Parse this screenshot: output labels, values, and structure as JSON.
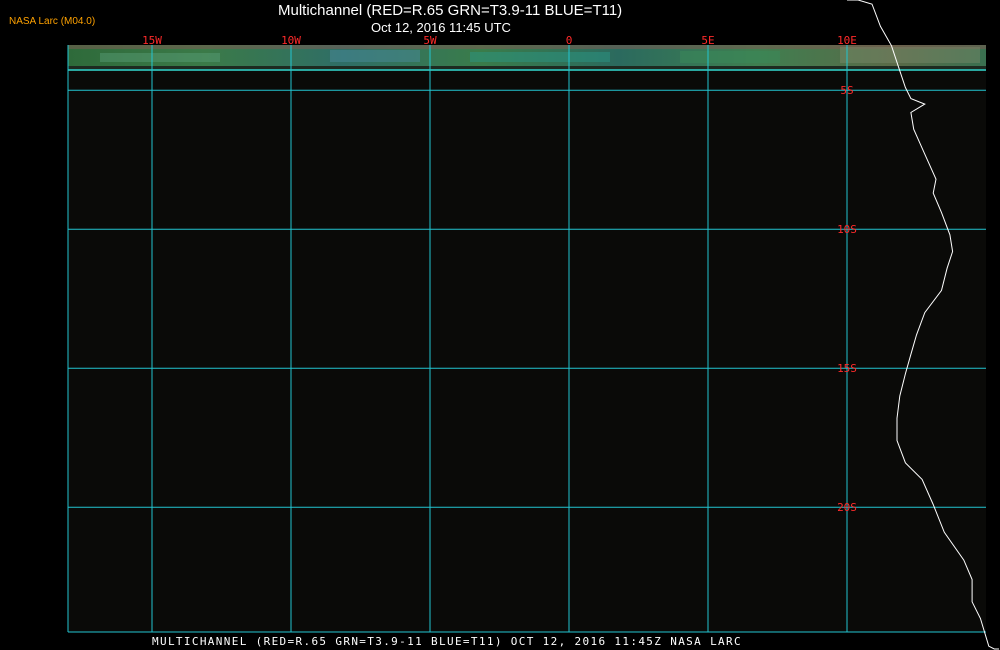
{
  "header": {
    "product_id": "NASA Larc (M04.0)",
    "title": "Multichannel (RED=R.65 GRN=T3.9-11 BLUE=T11)",
    "subtitle": "Oct 12, 2016 11:45 UTC"
  },
  "footer": {
    "caption": "MULTICHANNEL (RED=R.65 GRN=T3.9-11 BLUE=T11) OCT 12, 2016 11:45Z  NASA LARC"
  },
  "map": {
    "colors": {
      "background": "#000000",
      "panel": "#0a0a08",
      "grid": "#22c4d0",
      "grid_labels": "#ff2a2a",
      "coastline": "#ffffff",
      "imagery_green": "#2e6e3e",
      "imagery_teal": "#2aa8a0"
    },
    "longitude_labels": [
      {
        "lon": -15,
        "label": "15W"
      },
      {
        "lon": -10,
        "label": "10W"
      },
      {
        "lon": -5,
        "label": "5W"
      },
      {
        "lon": 0,
        "label": "0"
      },
      {
        "lon": 5,
        "label": "5E"
      },
      {
        "lon": 10,
        "label": "10E"
      }
    ],
    "latitude_labels": [
      {
        "lat": -5,
        "label": "5S"
      },
      {
        "lat": -10,
        "label": "10S"
      },
      {
        "lat": -15,
        "label": "15S"
      },
      {
        "lat": -20,
        "label": "20S"
      }
    ],
    "coastline": [
      [
        10.0,
        -0.3
      ],
      [
        10.4,
        -1.0
      ],
      [
        10.9,
        -1.9
      ],
      [
        11.2,
        -2.7
      ],
      [
        11.6,
        -3.4
      ],
      [
        11.9,
        -4.3
      ],
      [
        12.1,
        -4.9
      ],
      [
        12.3,
        -5.3
      ],
      [
        12.8,
        -5.5
      ],
      [
        12.3,
        -5.8
      ],
      [
        12.4,
        -6.4
      ],
      [
        12.8,
        -7.3
      ],
      [
        13.2,
        -8.2
      ],
      [
        13.1,
        -8.7
      ],
      [
        13.4,
        -9.4
      ],
      [
        13.7,
        -10.2
      ],
      [
        13.8,
        -10.8
      ],
      [
        13.6,
        -11.4
      ],
      [
        13.4,
        -12.2
      ],
      [
        12.8,
        -13.0
      ],
      [
        12.5,
        -13.8
      ],
      [
        12.3,
        -14.5
      ],
      [
        12.1,
        -15.2
      ],
      [
        11.9,
        -16.0
      ],
      [
        11.8,
        -16.8
      ],
      [
        11.8,
        -17.6
      ],
      [
        12.1,
        -18.4
      ],
      [
        12.7,
        -19.0
      ],
      [
        13.1,
        -19.9
      ],
      [
        13.5,
        -20.9
      ],
      [
        14.2,
        -21.9
      ],
      [
        14.5,
        -22.6
      ],
      [
        14.5,
        -23.4
      ],
      [
        14.8,
        -24.0
      ],
      [
        15.1,
        -25.0
      ],
      [
        15.3,
        -25.5
      ],
      [
        15.3,
        -26.1
      ],
      [
        15.6,
        -27.0
      ]
    ]
  }
}
